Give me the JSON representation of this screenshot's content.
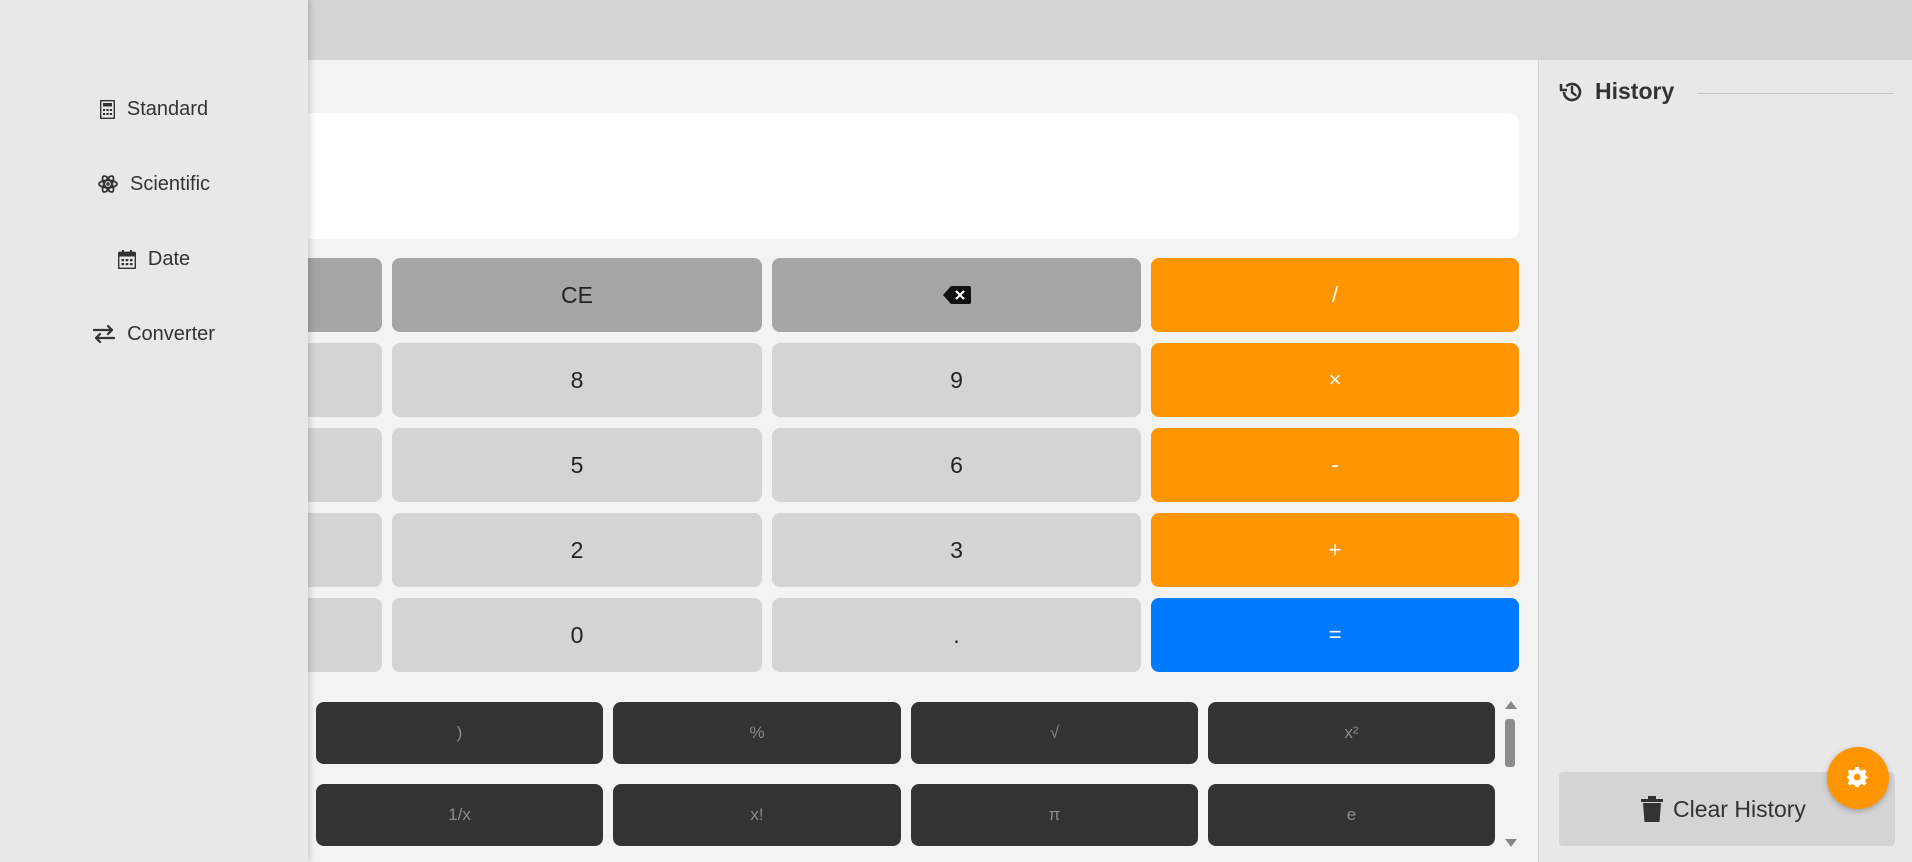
{
  "sidebar": {
    "items": [
      {
        "label": "Standard",
        "icon": "calculator-icon"
      },
      {
        "label": "Scientific",
        "icon": "atom-icon"
      },
      {
        "label": "Date",
        "icon": "calendar-icon"
      },
      {
        "label": "Converter",
        "icon": "exchange-icon"
      }
    ]
  },
  "keypad": {
    "ce": "CE",
    "backspace_icon": "backspace-icon",
    "divide": "/",
    "multiply": "×",
    "minus": "-",
    "plus": "+",
    "equals": "=",
    "eight": "8",
    "nine": "9",
    "five": "5",
    "six": "6",
    "two": "2",
    "three": "3",
    "zero": "0",
    "decimal": "."
  },
  "scientific": {
    "row1": [
      ")",
      "%",
      "√",
      "x²"
    ],
    "row2": [
      "1/x",
      "x!",
      "π",
      "e"
    ]
  },
  "history": {
    "title": "History",
    "clear_label": "Clear History"
  },
  "colors": {
    "operator": "#ff9500",
    "equals": "#007bff",
    "function": "#a5a5a5",
    "number": "#d4d4d4",
    "scientific": "#333333"
  }
}
